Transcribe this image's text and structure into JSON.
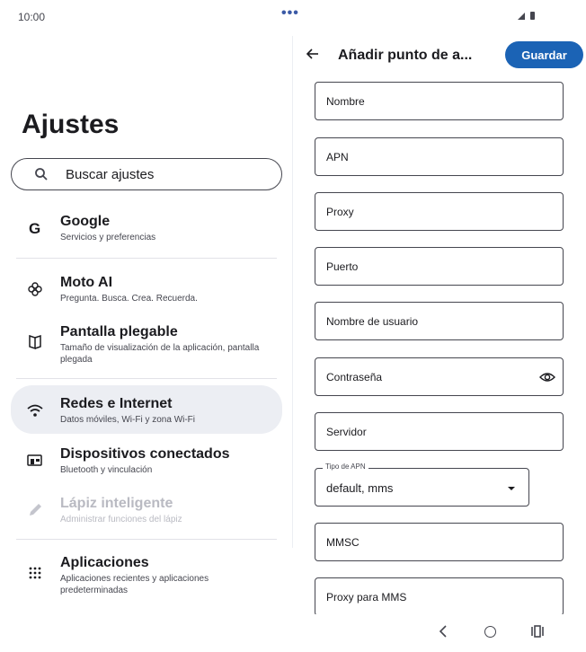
{
  "status_bar": {
    "time": "10:00"
  },
  "left": {
    "title": "Ajustes",
    "search_placeholder": "Buscar ajustes",
    "items": [
      {
        "icon": "google-icon",
        "title": "Google",
        "subtitle": "Servicios y preferencias"
      },
      {
        "icon": "moto-ai-icon",
        "title": "Moto AI",
        "subtitle": "Pregunta. Busca. Crea. Recuerda."
      },
      {
        "icon": "foldable-display-icon",
        "title": "Pantalla plegable",
        "subtitle": "Tamaño de visualización de la aplicación, pantalla plegada"
      },
      {
        "icon": "wifi-icon",
        "title": "Redes e Internet",
        "subtitle": "Datos móviles, Wi-Fi y zona Wi-Fi",
        "selected": true
      },
      {
        "icon": "connected-devices-icon",
        "title": "Dispositivos conectados",
        "subtitle": "Bluetooth y vinculación"
      },
      {
        "icon": "pen-icon",
        "title": "Lápiz inteligente",
        "subtitle": "Administrar funciones del lápiz",
        "disabled": true
      },
      {
        "icon": "apps-grid-icon",
        "title": "Aplicaciones",
        "subtitle": "Aplicaciones recientes y aplicaciones predeterminadas"
      }
    ]
  },
  "right": {
    "title": "Añadir punto de a...",
    "save_label": "Guardar",
    "fields": {
      "name": "Nombre",
      "apn": "APN",
      "proxy": "Proxy",
      "port": "Puerto",
      "username": "Nombre de usuario",
      "password": "Contraseña",
      "server": "Servidor",
      "mmsc": "MMSC",
      "mms_proxy": "Proxy para MMS"
    },
    "apn_type": {
      "label": "Tipo de APN",
      "value": "default, mms"
    }
  },
  "colors": {
    "accent": "#1b63b5",
    "selected_bg": "#eceef3",
    "text": "#1b1b1f"
  }
}
